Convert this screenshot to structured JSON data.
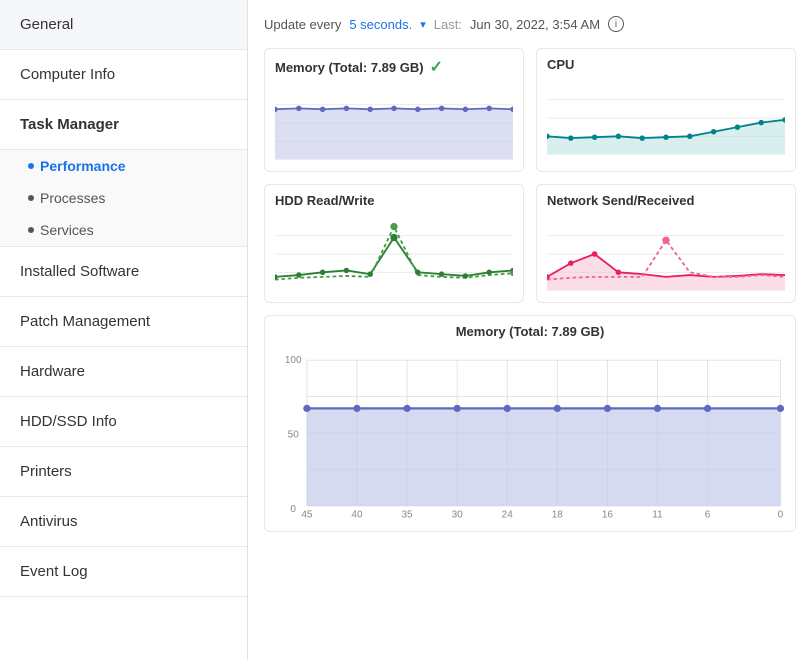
{
  "sidebar": {
    "items": [
      {
        "label": "General",
        "type": "top"
      },
      {
        "label": "Computer Info",
        "type": "top"
      },
      {
        "label": "Task Manager",
        "type": "section-header"
      },
      {
        "label": "Performance",
        "type": "sub",
        "active": true
      },
      {
        "label": "Processes",
        "type": "sub",
        "active": false
      },
      {
        "label": "Services",
        "type": "sub",
        "active": false
      },
      {
        "label": "Installed Software",
        "type": "top"
      },
      {
        "label": "Patch Management",
        "type": "top"
      },
      {
        "label": "Hardware",
        "type": "top"
      },
      {
        "label": "HDD/SSD Info",
        "type": "top"
      },
      {
        "label": "Printers",
        "type": "top"
      },
      {
        "label": "Antivirus",
        "type": "top"
      },
      {
        "label": "Event Log",
        "type": "top"
      }
    ]
  },
  "topbar": {
    "update_prefix": "Update every",
    "update_value": "5 seconds.",
    "separator": "Last:",
    "last_value": "Jun 30, 2022, 3:54 AM"
  },
  "charts": {
    "memory_small": {
      "title": "Memory (Total: 7.89 GB)",
      "has_check": true
    },
    "cpu": {
      "title": "CPU",
      "has_check": false
    },
    "hdd": {
      "title": "HDD Read/Write",
      "has_check": false
    },
    "network": {
      "title": "Network Send/Received",
      "has_check": false
    },
    "memory_big": {
      "title": "Memory (Total: 7.89 GB)",
      "y_max": "100",
      "y_mid": "50",
      "y_min": "0",
      "x_labels": [
        "45",
        "40",
        "35",
        "30",
        "24",
        "18",
        "16",
        "11",
        "6",
        "0"
      ]
    }
  }
}
